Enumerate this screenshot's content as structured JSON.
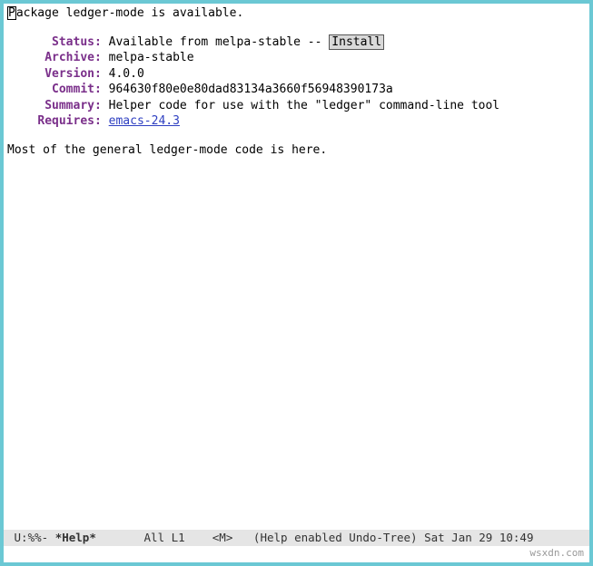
{
  "header": {
    "first_char": "P",
    "rest": "ackage ledger-mode is available."
  },
  "fields": {
    "status": {
      "label": "Status",
      "prefix": "Available from melpa-stable -- ",
      "button": "Install"
    },
    "archive": {
      "label": "Archive",
      "value": "melpa-stable"
    },
    "version": {
      "label": "Version",
      "value": "4.0.0"
    },
    "commit": {
      "label": "Commit",
      "value": "964630f80e0e80dad83134a3660f56948390173a"
    },
    "summary": {
      "label": "Summary",
      "value": "Helper code for use with the \"ledger\" command-line tool"
    },
    "requires": {
      "label": "Requires",
      "link": "emacs-24.3"
    }
  },
  "body": "Most of the general ledger-mode code is here.",
  "modeline": {
    "left": " U:%%- ",
    "buffer": "*Help*",
    "mid": "       All L1    <M>   (Help enabled Undo-Tree) Sat Jan 29 10:49"
  },
  "watermark": "wsxdn.com"
}
